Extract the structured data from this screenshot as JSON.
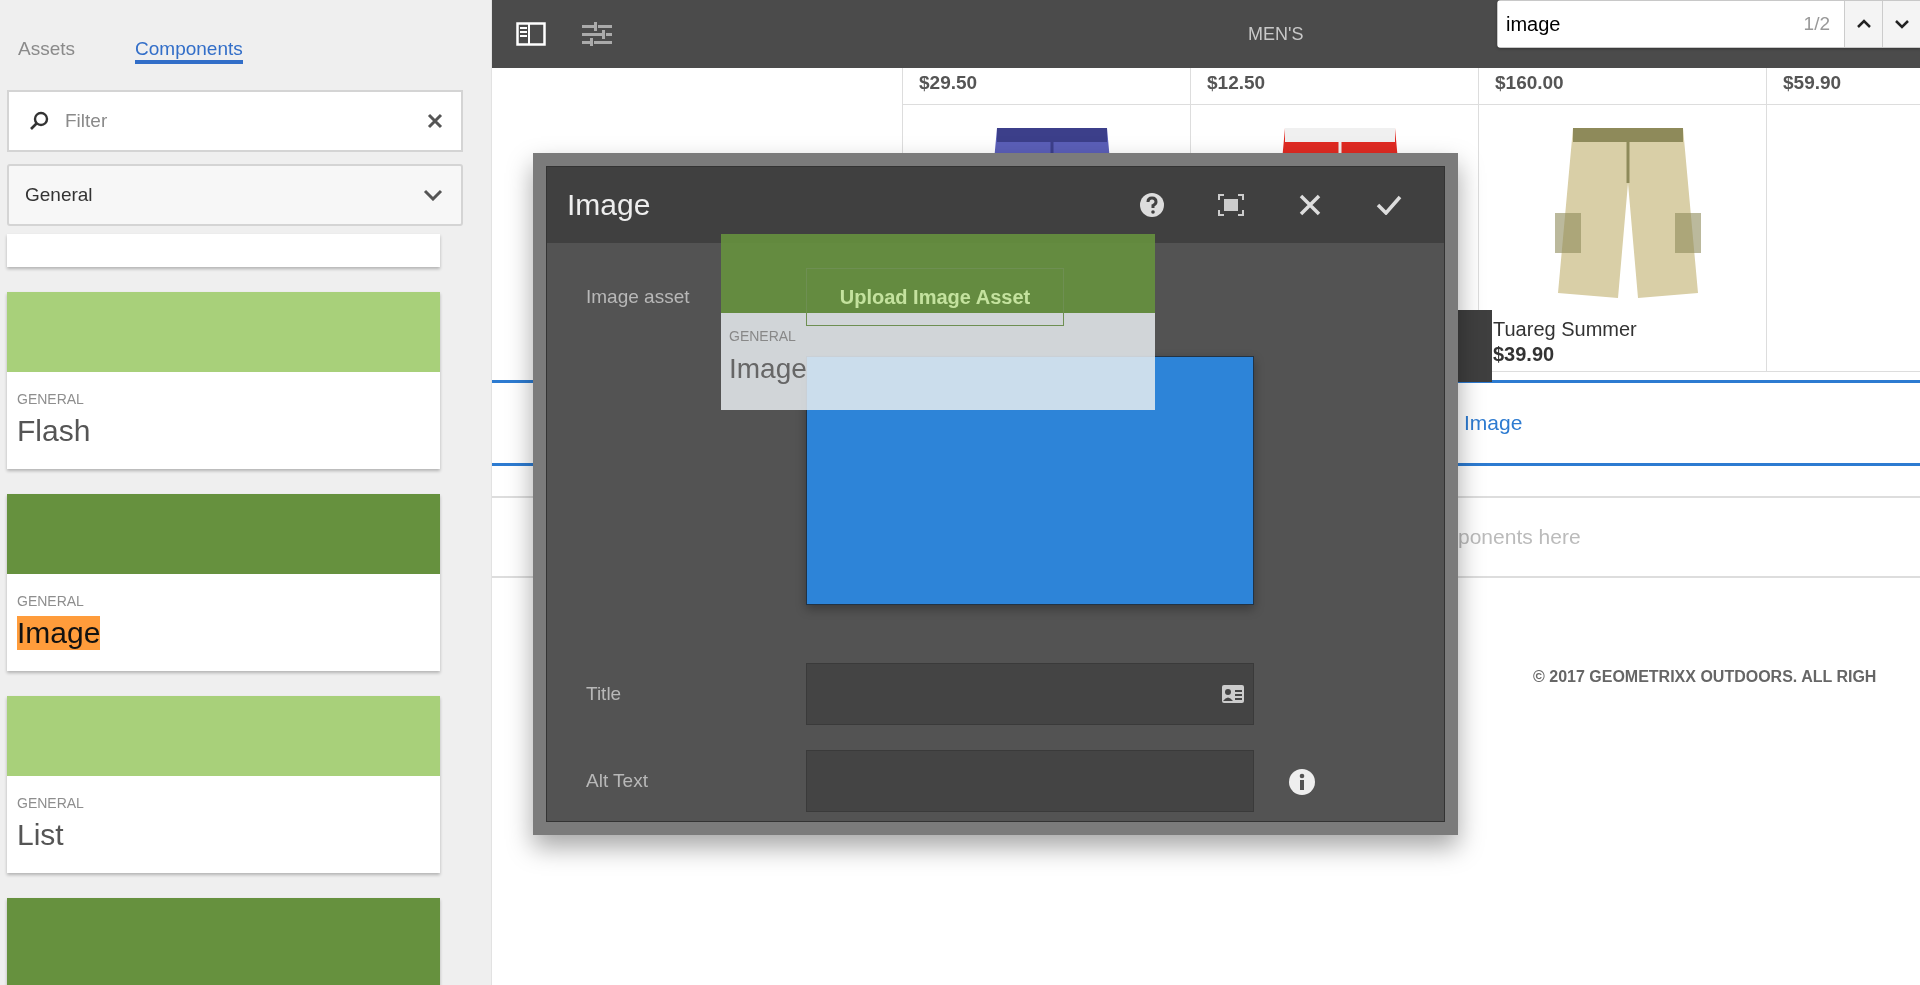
{
  "sidebar": {
    "tabs": [
      {
        "label": "Assets",
        "selected": false
      },
      {
        "label": "Components",
        "selected": true
      }
    ],
    "filter": {
      "placeholder": "Filter"
    },
    "group_select": {
      "value": "General"
    },
    "components": [
      {
        "kind": "clipped_top"
      },
      {
        "kind": "card",
        "group": "GENERAL",
        "name": "Flash",
        "color": "#a8d07a",
        "search_highlight": false
      },
      {
        "kind": "card",
        "group": "GENERAL",
        "name": "Image",
        "color": "#66913e",
        "search_highlight": true
      },
      {
        "kind": "card",
        "group": "GENERAL",
        "name": "List",
        "color": "#a8d07a",
        "search_highlight": false
      },
      {
        "kind": "clipped_bottom",
        "color": "#66913e"
      }
    ]
  },
  "top_bar": {
    "title": "MEN'S"
  },
  "find_bar": {
    "value": "image",
    "count": "1/2"
  },
  "product_grid": {
    "prices": [
      "$29.50",
      "$12.50",
      "$160.00",
      "$59.90"
    ],
    "products": [
      {
        "kind": "picture"
      },
      {
        "kind": "picture"
      },
      {
        "kind": "picture",
        "name": "Tuareg Summer",
        "price": "$39.90"
      },
      {
        "kind": "empty"
      }
    ]
  },
  "page": {
    "selected_component": "Image",
    "drop_hint": "ponents here",
    "footer": "© 2017 GEOMETRIXX OUTDOORS. ALL RIGH"
  },
  "dialog": {
    "title": "Image",
    "fields": [
      {
        "kind": "asset",
        "label": "Image asset",
        "button": "Upload Image Asset"
      },
      {
        "kind": "text",
        "label": "Title"
      },
      {
        "kind": "text_info",
        "label": "Alt Text"
      }
    ]
  },
  "drag_ghost": {
    "group": "GENERAL",
    "name": "Image"
  }
}
